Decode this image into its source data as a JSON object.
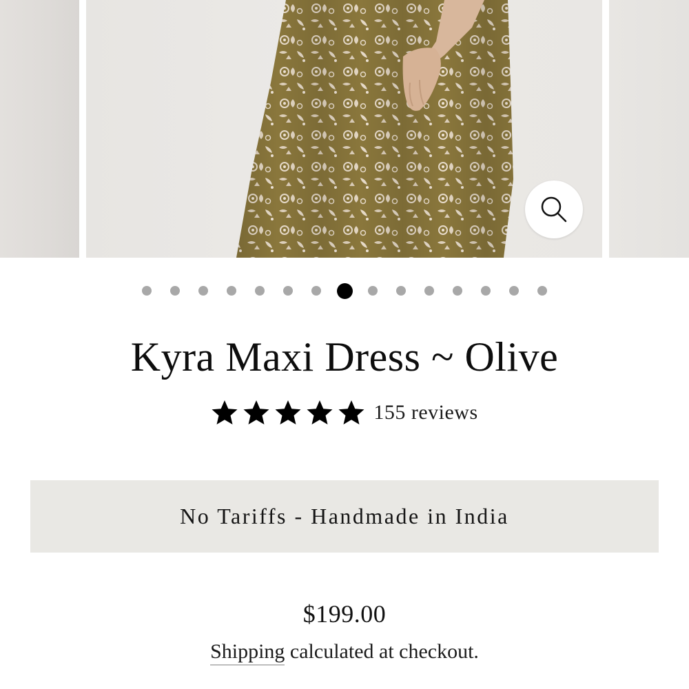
{
  "product": {
    "title": "Kyra Maxi Dress ~ Olive",
    "rating": 5,
    "reviews_label": "155 reviews",
    "banner": "No Tariffs - Handmade in India",
    "price": "$199.00",
    "shipping_link": "Shipping",
    "shipping_rest": " calculated at checkout."
  },
  "carousel": {
    "total_slides": 15,
    "active_index": 7,
    "zoom_icon": "search-icon"
  },
  "colors": {
    "dot_inactive": "#a8a8a8",
    "dot_active": "#000000",
    "banner_bg": "#e9e8e4",
    "dress_olive": "#8c7a3e"
  }
}
